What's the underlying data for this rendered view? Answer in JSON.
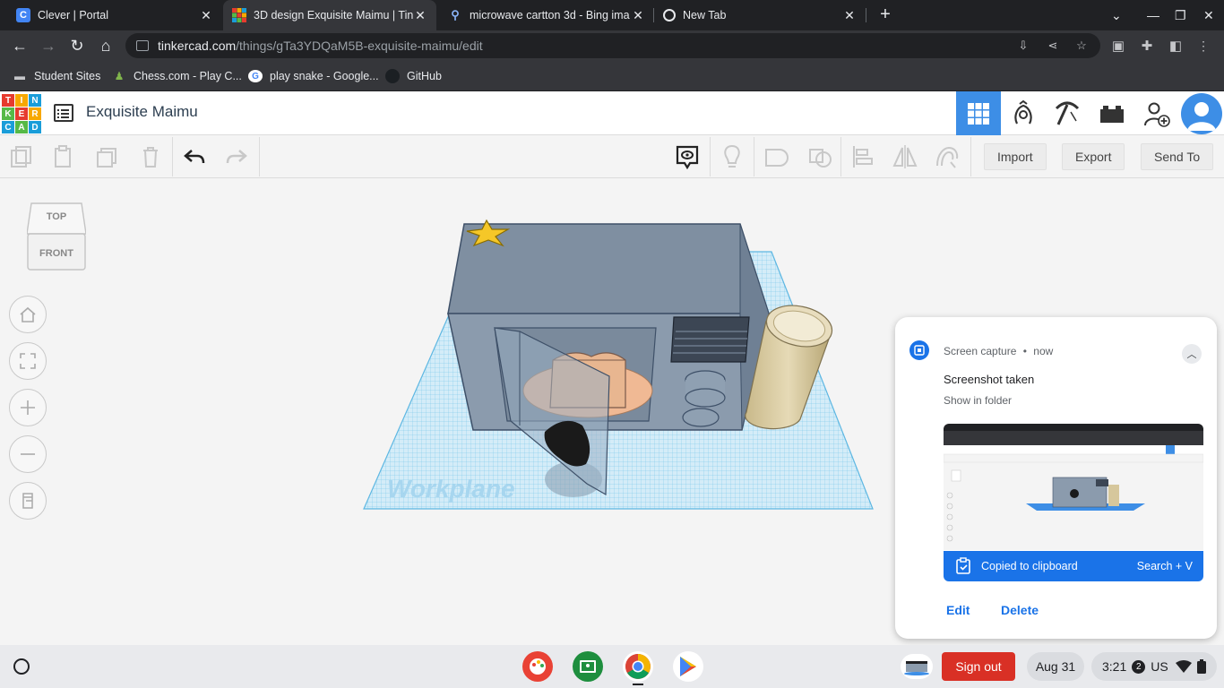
{
  "browser": {
    "tabs": [
      {
        "title": "Clever | Portal",
        "favicon": "clever-icon"
      },
      {
        "title": "3D design Exquisite Maimu | Tin",
        "favicon": "tinkercad-icon",
        "active": true
      },
      {
        "title": "microwave cartton 3d - Bing ima",
        "favicon": "bing-search-icon"
      },
      {
        "title": "New Tab",
        "favicon": "chrome-icon"
      }
    ],
    "new_tab_label": "+",
    "url_host": "tinkercad.com",
    "url_path": "/things/gTa3YDQaM5B-exquisite-maimu/edit",
    "bookmarks": [
      {
        "label": "Student Sites",
        "icon": "folder-icon"
      },
      {
        "label": "Chess.com - Play C...",
        "icon": "chess-pawn-icon"
      },
      {
        "label": "play snake - Google...",
        "icon": "google-icon"
      },
      {
        "label": "GitHub",
        "icon": "github-icon"
      }
    ]
  },
  "tinkercad": {
    "logo_letters": [
      "T",
      "I",
      "N",
      "K",
      "E",
      "R",
      "C",
      "A",
      "D"
    ],
    "design_title": "Exquisite Maimu",
    "import_label": "Import",
    "export_label": "Export",
    "send_to_label": "Send To",
    "viewcube_top": "TOP",
    "viewcube_front": "FRONT",
    "workplane_label": "Workplane"
  },
  "notification": {
    "source": "Screen capture",
    "time": "now",
    "separator": "•",
    "title": "Screenshot taken",
    "subtitle": "Show in folder",
    "clipboard_label": "Copied to clipboard",
    "paste_hint": "Search + V",
    "edit_label": "Edit",
    "delete_label": "Delete"
  },
  "shelf": {
    "sign_out_label": "Sign out",
    "date": "Aug 31",
    "time": "3:21",
    "notification_count": "2",
    "locale": "US"
  },
  "colors": {
    "accent_blue": "#3d8ee6",
    "chrome_dark": "#202124",
    "signout_red": "#d93025"
  }
}
